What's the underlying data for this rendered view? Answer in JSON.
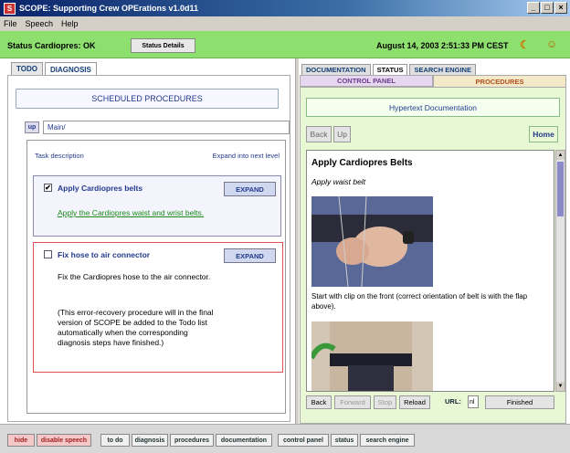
{
  "window": {
    "title": "SCOPE: Supporting Crew OPErations v1.0d11",
    "controls": [
      "_",
      "□",
      "×"
    ]
  },
  "menu": [
    "File",
    "Speech",
    "Help"
  ],
  "status": {
    "label": "Status Cardiopres:  OK",
    "details_button": "Status Details",
    "datetime": "August 14, 2003 2:51:33 PM CEST"
  },
  "left": {
    "tabs": [
      "TODO",
      "DIAGNOSIS"
    ],
    "active_tab": "DIAGNOSIS",
    "header": "SCHEDULED PROCEDURES",
    "up_button": "up",
    "path": "Main/",
    "task_header": "Task description",
    "expand_header": "Expand into next level",
    "tasks": [
      {
        "checked": true,
        "checkbox": "✔",
        "title": "Apply Cardiopres belts",
        "expand": "EXPAND",
        "description": "Apply the Cardiopres waist and wrist belts."
      },
      {
        "checked": false,
        "checkbox": "",
        "title": "Fix hose to air connector",
        "expand": "EXPAND",
        "description": "Fix the Cardiopres hose to the air connector.",
        "note": "(This error-recovery procedure will in the final version of SCOPE be added to the Todo list automatically when the corresponding diagnosis steps have finished.)"
      }
    ]
  },
  "right": {
    "tabs": [
      "DOCUMENTATION",
      "STATUS",
      "SEARCH ENGINE"
    ],
    "active_tab": "STATUS",
    "subtabs": [
      "CONTROL PANEL",
      "PROCEDURES"
    ],
    "header": "Hypertext Documentation",
    "nav": {
      "back": "Back",
      "up": "Up",
      "home": "Home"
    },
    "doc": {
      "title": "Apply Cardiopres Belts",
      "subtitle": "Apply waist belt",
      "caption": "Start with clip on the front (correct orientation of belt is with the flap above)."
    },
    "bottom_nav": {
      "back": "Back",
      "forward": "Forward",
      "stop": "Stop",
      "reload": "Reload",
      "url_label": "URL:",
      "url_value": "nl",
      "finished": "Finished"
    }
  },
  "bottom": {
    "buttons": [
      "hide",
      "disable speech",
      "to do",
      "diagnosis",
      "procedures",
      "documentation",
      "control panel",
      "status",
      "search engine"
    ]
  },
  "colors": {
    "status_green": "#8ee06e",
    "link_green": "#1a8a1a",
    "accent_blue": "#233a8e",
    "error_red": "#e05050"
  }
}
